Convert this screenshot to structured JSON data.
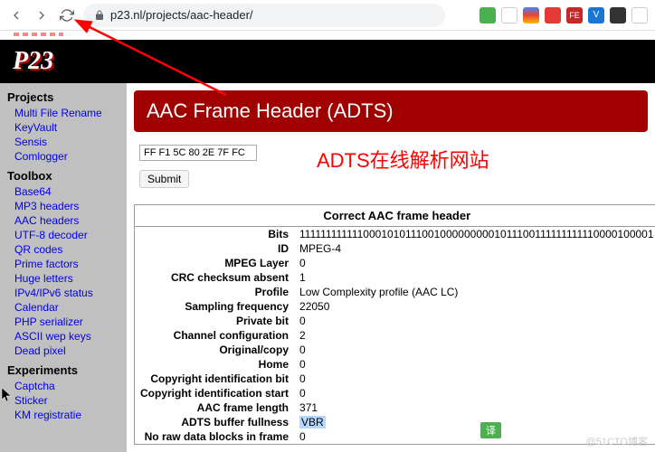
{
  "browser": {
    "url": "p23.nl/projects/aac-header/"
  },
  "logo": "P23",
  "sidebar": {
    "sections": [
      {
        "heading": "Projects",
        "items": [
          "Multi File Rename",
          "KeyVault",
          "Sensis",
          "Comlogger"
        ]
      },
      {
        "heading": "Toolbox",
        "items": [
          "Base64",
          "MP3 headers",
          "AAC headers",
          "UTF-8 decoder",
          "QR codes",
          "Prime factors",
          "Huge letters",
          "IPv4/IPv6 status",
          "Calendar",
          "PHP serializer",
          "ASCII wep keys",
          "Dead pixel"
        ]
      },
      {
        "heading": "Experiments",
        "items": [
          "Captcha",
          "Sticker",
          "KM registratie"
        ]
      }
    ]
  },
  "content": {
    "title": "AAC Frame Header (ADTS)",
    "input_value": "FF F1 5C 80 2E 7F FC",
    "submit_label": "Submit",
    "annotation": "ADTS在线解析网站",
    "table_title": "Correct AAC frame header",
    "rows": [
      {
        "label": "Bits",
        "value": "11111111111100010101110010000000001011100111111111110000100001"
      },
      {
        "label": "ID",
        "value": "MPEG-4"
      },
      {
        "label": "MPEG Layer",
        "value": "0"
      },
      {
        "label": "CRC checksum absent",
        "value": "1"
      },
      {
        "label": "Profile",
        "value": "Low Complexity profile (AAC LC)"
      },
      {
        "label": "Sampling frequency",
        "value": "22050"
      },
      {
        "label": "Private bit",
        "value": "0"
      },
      {
        "label": "Channel configuration",
        "value": "2"
      },
      {
        "label": "Original/copy",
        "value": "0"
      },
      {
        "label": "Home",
        "value": "0"
      },
      {
        "label": "Copyright identification bit",
        "value": "0"
      },
      {
        "label": "Copyright identification start",
        "value": "0"
      },
      {
        "label": "AAC frame length",
        "value": "371"
      },
      {
        "label": "ADTS buffer fullness",
        "value": "VBR"
      },
      {
        "label": "No raw data blocks in frame",
        "value": "0"
      }
    ]
  },
  "translate_badge": "译",
  "watermark": "@51CTO博客"
}
